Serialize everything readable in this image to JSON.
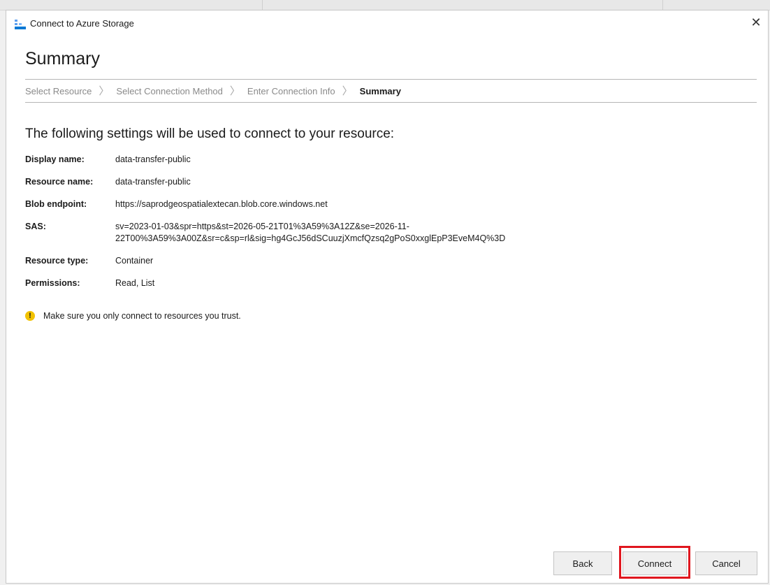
{
  "window": {
    "title": "Connect to Azure Storage",
    "close_glyph": "✕",
    "icon": "azure-storage-icon"
  },
  "page_title": "Summary",
  "breadcrumb": [
    {
      "label": "Select Resource",
      "current": false
    },
    {
      "label": "Select Connection Method",
      "current": false
    },
    {
      "label": "Enter Connection Info",
      "current": false
    },
    {
      "label": "Summary",
      "current": true
    }
  ],
  "breadcrumb_separator": "〉",
  "intro": "The following settings will be used to connect to your resource:",
  "settings": [
    {
      "label": "Display name:",
      "value": "data-transfer-public"
    },
    {
      "label": "Resource name:",
      "value": "data-transfer-public"
    },
    {
      "label": "Blob endpoint:",
      "value": "https://saprodgeospatialextecan.blob.core.windows.net"
    },
    {
      "label": "SAS:",
      "value": "sv=2023-01-03&spr=https&st=2026-05-21T01%3A59%3A12Z&se=2026-11-\n22T00%3A59%3A00Z&sr=c&sp=rl&sig=hg4GcJ56dSCuuzjXmcfQzsq2gPoS0xxglEpP3EveM4Q%3D"
    },
    {
      "label": "Resource type:",
      "value": "Container"
    },
    {
      "label": "Permissions:",
      "value": "Read, List"
    }
  ],
  "warning": {
    "icon": "warning-icon",
    "glyph": "!",
    "text": "Make sure you only connect to resources you trust."
  },
  "buttons": {
    "back": "Back",
    "connect": "Connect",
    "cancel": "Cancel"
  },
  "colors": {
    "highlight": "#e0161e",
    "warning": "#f2c200"
  }
}
